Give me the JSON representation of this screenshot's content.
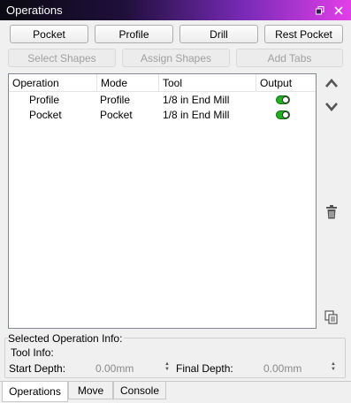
{
  "window": {
    "title": "Operations"
  },
  "toolbar": {
    "pocket_label": "Pocket",
    "profile_label": "Profile",
    "drill_label": "Drill",
    "rest_pocket_label": "Rest Pocket",
    "select_shapes_label": "Select Shapes",
    "assign_shapes_label": "Assign Shapes",
    "add_tabs_label": "Add Tabs"
  },
  "table": {
    "columns": [
      "Operation",
      "Mode",
      "Tool",
      "Output"
    ],
    "rows": [
      {
        "operation": "Profile",
        "mode": "Profile",
        "tool": "1/8 in End Mill",
        "output": true
      },
      {
        "operation": "Pocket",
        "mode": "Pocket",
        "tool": "1/8 in End Mill",
        "output": true
      }
    ]
  },
  "info": {
    "group_label": "Selected Operation Info:",
    "tool_info_label": "Tool Info:",
    "start_depth_label": "Start Depth:",
    "start_depth_value": "0.00mm",
    "final_depth_label": "Final Depth:",
    "final_depth_value": "0.00mm"
  },
  "tabs": [
    {
      "label": "Operations",
      "active": true
    },
    {
      "label": "Move",
      "active": false
    },
    {
      "label": "Console",
      "active": false
    }
  ],
  "colors": {
    "output_on": "#20b020",
    "title_gradient_end": "#e33ee8"
  },
  "icons": [
    "restore-icon",
    "close-icon",
    "move-up-icon",
    "move-down-icon",
    "delete-icon",
    "duplicate-icon"
  ]
}
